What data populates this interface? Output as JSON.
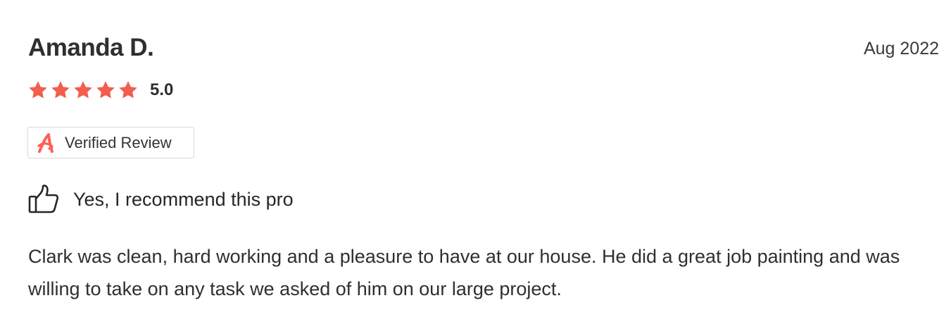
{
  "review": {
    "reviewer_name": "Amanda D.",
    "date": "Aug 2022",
    "rating": {
      "stars": 5,
      "max_stars": 5,
      "value_text": "5.0"
    },
    "badge": {
      "label": "Verified Review",
      "icon": "angi-logo-icon"
    },
    "recommendation": {
      "label": "Yes, I recommend this pro",
      "icon": "thumbs-up-icon"
    },
    "body": "Clark was clean, hard working and a pleasure to have at our house. He did a great job painting and was willing to take on any task we asked of him on our large project."
  },
  "colors": {
    "star": "#F15E4E",
    "brand": "#FF6153",
    "text": "#2F2F2F",
    "border": "#D9D9D9"
  }
}
